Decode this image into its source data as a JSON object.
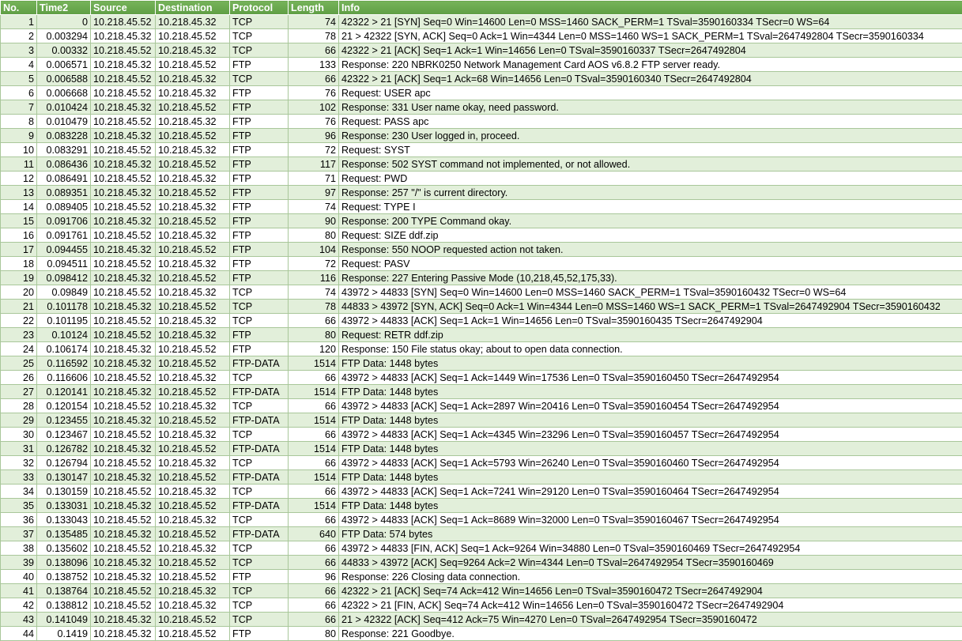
{
  "columns": [
    "No.",
    "Time2",
    "Source",
    "Destination",
    "Protocol",
    "Length",
    "Info"
  ],
  "rows": [
    [
      "1",
      "0",
      "10.218.45.52",
      "10.218.45.32",
      "TCP",
      "74",
      "42322  > 21 [SYN] Seq=0 Win=14600 Len=0 MSS=1460 SACK_PERM=1 TSval=3590160334 TSecr=0 WS=64"
    ],
    [
      "2",
      "0.003294",
      "10.218.45.32",
      "10.218.45.52",
      "TCP",
      "78",
      "21  > 42322 [SYN, ACK] Seq=0 Ack=1 Win=4344 Len=0 MSS=1460 WS=1 SACK_PERM=1 TSval=2647492804 TSecr=3590160334"
    ],
    [
      "3",
      "0.00332",
      "10.218.45.52",
      "10.218.45.32",
      "TCP",
      "66",
      "42322  > 21 [ACK] Seq=1 Ack=1 Win=14656 Len=0 TSval=3590160337 TSecr=2647492804"
    ],
    [
      "4",
      "0.006571",
      "10.218.45.32",
      "10.218.45.52",
      "FTP",
      "133",
      "Response: 220 NBRK0250 Network Management Card AOS v6.8.2 FTP server ready."
    ],
    [
      "5",
      "0.006588",
      "10.218.45.52",
      "10.218.45.32",
      "TCP",
      "66",
      "42322  > 21 [ACK] Seq=1 Ack=68 Win=14656 Len=0 TSval=3590160340 TSecr=2647492804"
    ],
    [
      "6",
      "0.006668",
      "10.218.45.52",
      "10.218.45.32",
      "FTP",
      "76",
      "Request: USER apc"
    ],
    [
      "7",
      "0.010424",
      "10.218.45.32",
      "10.218.45.52",
      "FTP",
      "102",
      "Response: 331 User name okay, need password."
    ],
    [
      "8",
      "0.010479",
      "10.218.45.52",
      "10.218.45.32",
      "FTP",
      "76",
      "Request: PASS apc"
    ],
    [
      "9",
      "0.083228",
      "10.218.45.32",
      "10.218.45.52",
      "FTP",
      "96",
      "Response: 230 User logged in, proceed."
    ],
    [
      "10",
      "0.083291",
      "10.218.45.52",
      "10.218.45.32",
      "FTP",
      "72",
      "Request: SYST"
    ],
    [
      "11",
      "0.086436",
      "10.218.45.32",
      "10.218.45.52",
      "FTP",
      "117",
      "Response: 502 SYST command not implemented, or not allowed."
    ],
    [
      "12",
      "0.086491",
      "10.218.45.52",
      "10.218.45.32",
      "FTP",
      "71",
      "Request: PWD"
    ],
    [
      "13",
      "0.089351",
      "10.218.45.32",
      "10.218.45.52",
      "FTP",
      "97",
      "Response: 257 \"/\" is current directory."
    ],
    [
      "14",
      "0.089405",
      "10.218.45.52",
      "10.218.45.32",
      "FTP",
      "74",
      "Request: TYPE I"
    ],
    [
      "15",
      "0.091706",
      "10.218.45.32",
      "10.218.45.52",
      "FTP",
      "90",
      "Response: 200 TYPE Command okay."
    ],
    [
      "16",
      "0.091761",
      "10.218.45.52",
      "10.218.45.32",
      "FTP",
      "80",
      "Request: SIZE ddf.zip"
    ],
    [
      "17",
      "0.094455",
      "10.218.45.32",
      "10.218.45.52",
      "FTP",
      "104",
      "Response: 550 NOOP requested action not taken."
    ],
    [
      "18",
      "0.094511",
      "10.218.45.52",
      "10.218.45.32",
      "FTP",
      "72",
      "Request: PASV"
    ],
    [
      "19",
      "0.098412",
      "10.218.45.32",
      "10.218.45.52",
      "FTP",
      "116",
      "Response: 227 Entering Passive Mode (10,218,45,52,175,33)."
    ],
    [
      "20",
      "0.09849",
      "10.218.45.52",
      "10.218.45.32",
      "TCP",
      "74",
      "43972  > 44833 [SYN] Seq=0 Win=14600 Len=0 MSS=1460 SACK_PERM=1 TSval=3590160432 TSecr=0 WS=64"
    ],
    [
      "21",
      "0.101178",
      "10.218.45.32",
      "10.218.45.52",
      "TCP",
      "78",
      "44833  > 43972 [SYN, ACK] Seq=0 Ack=1 Win=4344 Len=0 MSS=1460 WS=1 SACK_PERM=1 TSval=2647492904 TSecr=3590160432"
    ],
    [
      "22",
      "0.101195",
      "10.218.45.52",
      "10.218.45.32",
      "TCP",
      "66",
      "43972  > 44833 [ACK] Seq=1 Ack=1 Win=14656 Len=0 TSval=3590160435 TSecr=2647492904"
    ],
    [
      "23",
      "0.10124",
      "10.218.45.52",
      "10.218.45.32",
      "FTP",
      "80",
      "Request: RETR ddf.zip"
    ],
    [
      "24",
      "0.106174",
      "10.218.45.32",
      "10.218.45.52",
      "FTP",
      "120",
      "Response: 150 File status okay; about to open data connection."
    ],
    [
      "25",
      "0.116592",
      "10.218.45.32",
      "10.218.45.52",
      "FTP-DATA",
      "1514",
      "FTP Data: 1448 bytes"
    ],
    [
      "26",
      "0.116606",
      "10.218.45.52",
      "10.218.45.32",
      "TCP",
      "66",
      "43972  > 44833 [ACK] Seq=1 Ack=1449 Win=17536 Len=0 TSval=3590160450 TSecr=2647492954"
    ],
    [
      "27",
      "0.120141",
      "10.218.45.32",
      "10.218.45.52",
      "FTP-DATA",
      "1514",
      "FTP Data: 1448 bytes"
    ],
    [
      "28",
      "0.120154",
      "10.218.45.52",
      "10.218.45.32",
      "TCP",
      "66",
      "43972  > 44833 [ACK] Seq=1 Ack=2897 Win=20416 Len=0 TSval=3590160454 TSecr=2647492954"
    ],
    [
      "29",
      "0.123455",
      "10.218.45.32",
      "10.218.45.52",
      "FTP-DATA",
      "1514",
      "FTP Data: 1448 bytes"
    ],
    [
      "30",
      "0.123467",
      "10.218.45.52",
      "10.218.45.32",
      "TCP",
      "66",
      "43972  > 44833 [ACK] Seq=1 Ack=4345 Win=23296 Len=0 TSval=3590160457 TSecr=2647492954"
    ],
    [
      "31",
      "0.126782",
      "10.218.45.32",
      "10.218.45.52",
      "FTP-DATA",
      "1514",
      "FTP Data: 1448 bytes"
    ],
    [
      "32",
      "0.126794",
      "10.218.45.52",
      "10.218.45.32",
      "TCP",
      "66",
      "43972  > 44833 [ACK] Seq=1 Ack=5793 Win=26240 Len=0 TSval=3590160460 TSecr=2647492954"
    ],
    [
      "33",
      "0.130147",
      "10.218.45.32",
      "10.218.45.52",
      "FTP-DATA",
      "1514",
      "FTP Data: 1448 bytes"
    ],
    [
      "34",
      "0.130159",
      "10.218.45.52",
      "10.218.45.32",
      "TCP",
      "66",
      "43972  > 44833 [ACK] Seq=1 Ack=7241 Win=29120 Len=0 TSval=3590160464 TSecr=2647492954"
    ],
    [
      "35",
      "0.133031",
      "10.218.45.32",
      "10.218.45.52",
      "FTP-DATA",
      "1514",
      "FTP Data: 1448 bytes"
    ],
    [
      "36",
      "0.133043",
      "10.218.45.52",
      "10.218.45.32",
      "TCP",
      "66",
      "43972  > 44833 [ACK] Seq=1 Ack=8689 Win=32000 Len=0 TSval=3590160467 TSecr=2647492954"
    ],
    [
      "37",
      "0.135485",
      "10.218.45.32",
      "10.218.45.52",
      "FTP-DATA",
      "640",
      "FTP Data: 574 bytes"
    ],
    [
      "38",
      "0.135602",
      "10.218.45.52",
      "10.218.45.32",
      "TCP",
      "66",
      "43972  > 44833 [FIN, ACK] Seq=1 Ack=9264 Win=34880 Len=0 TSval=3590160469 TSecr=2647492954"
    ],
    [
      "39",
      "0.138096",
      "10.218.45.32",
      "10.218.45.52",
      "TCP",
      "66",
      "44833  > 43972 [ACK] Seq=9264 Ack=2 Win=4344 Len=0 TSval=2647492954 TSecr=3590160469"
    ],
    [
      "40",
      "0.138752",
      "10.218.45.32",
      "10.218.45.52",
      "FTP",
      "96",
      "Response: 226 Closing data connection."
    ],
    [
      "41",
      "0.138764",
      "10.218.45.52",
      "10.218.45.32",
      "TCP",
      "66",
      "42322  > 21 [ACK] Seq=74 Ack=412 Win=14656 Len=0 TSval=3590160472 TSecr=2647492904"
    ],
    [
      "42",
      "0.138812",
      "10.218.45.52",
      "10.218.45.32",
      "TCP",
      "66",
      "42322  > 21 [FIN, ACK] Seq=74 Ack=412 Win=14656 Len=0 TSval=3590160472 TSecr=2647492904"
    ],
    [
      "43",
      "0.141049",
      "10.218.45.32",
      "10.218.45.52",
      "TCP",
      "66",
      "21  > 42322 [ACK] Seq=412 Ack=75 Win=4270 Len=0 TSval=2647492954 TSecr=3590160472"
    ],
    [
      "44",
      "0.1419",
      "10.218.45.32",
      "10.218.45.52",
      "FTP",
      "80",
      "Response: 221 Goodbye."
    ]
  ],
  "colors": {
    "header_bg": "#6aa84f",
    "header_text": "#ffffff",
    "row_band": "#e2efda",
    "row_plain": "#ffffff",
    "grid": "#a9c79a"
  }
}
